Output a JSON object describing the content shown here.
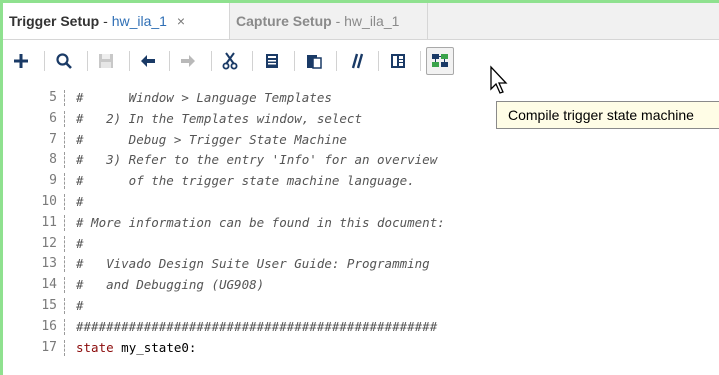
{
  "tabs": [
    {
      "title": "Trigger Setup",
      "sep": " - ",
      "subtitle": "hw_ila_1",
      "close": "×",
      "active": true
    },
    {
      "title": "Capture Setup",
      "sep": " - ",
      "subtitle": "hw_ila_1",
      "active": false
    }
  ],
  "toolbar": {
    "icons": [
      "add-icon",
      "search-icon",
      "save-icon",
      "undo-icon",
      "redo-icon",
      "cut-icon",
      "copy-icon",
      "paste-icon",
      "comment-toggle-icon",
      "insert-template-icon",
      "compile-icon"
    ]
  },
  "tooltip": {
    "text": "Compile trigger state machine"
  },
  "editor": {
    "lines": [
      {
        "num": "5",
        "text": "#      Window > Language Templates"
      },
      {
        "num": "6",
        "text": "#   2) In the Templates window, select"
      },
      {
        "num": "7",
        "text": "#      Debug > Trigger State Machine"
      },
      {
        "num": "8",
        "text": "#   3) Refer to the entry 'Info' for an overview"
      },
      {
        "num": "9",
        "text": "#      of the trigger state machine language."
      },
      {
        "num": "10",
        "text": "#"
      },
      {
        "num": "11",
        "text": "# More information can be found in this document:"
      },
      {
        "num": "12",
        "text": "#"
      },
      {
        "num": "13",
        "text": "#   Vivado Design Suite User Guide: Programming"
      },
      {
        "num": "14",
        "text": "#   and Debugging (UG908)"
      },
      {
        "num": "15",
        "text": "#"
      },
      {
        "num": "16",
        "text": "################################################"
      },
      {
        "num": "17",
        "keyword": "state",
        "text": " my_state0:"
      }
    ]
  },
  "colors": {
    "frame_border": "#8fe18f",
    "link_blue": "#2f6fb5",
    "keyword": "#8b0a0a",
    "tooltip_bg": "#fffde6"
  }
}
